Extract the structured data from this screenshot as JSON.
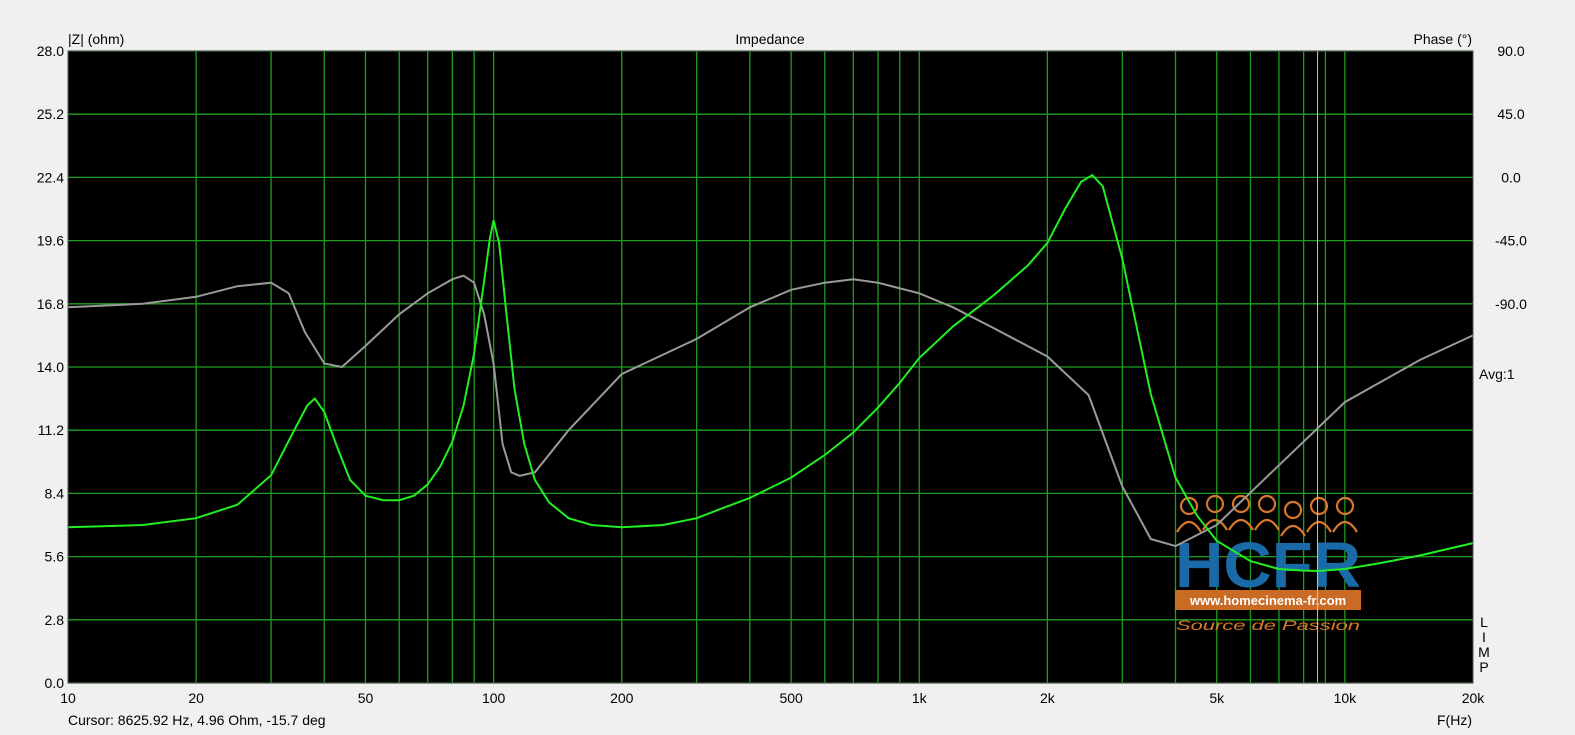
{
  "chart_data": {
    "type": "line",
    "title": "Impedance",
    "left_axis_label": "|Z| (ohm)",
    "right_axis_label": "Phase (°)",
    "x_axis_label": "F(Hz)",
    "x_scale": "log",
    "xlim": [
      10,
      20000
    ],
    "ylim_left": [
      0,
      28
    ],
    "ylim_right": [
      -90,
      90
    ],
    "left_ticks": [
      "0.0",
      "2.8",
      "5.6",
      "8.4",
      "11.2",
      "14.0",
      "16.8",
      "19.6",
      "22.4",
      "25.2",
      "28.0"
    ],
    "right_ticks": [
      {
        "label": "90.0",
        "value": 28.0
      },
      {
        "label": "45.0",
        "value": 25.2
      },
      {
        "label": "0.0",
        "value": 22.4
      },
      {
        "label": "-45.0",
        "value": 19.6
      },
      {
        "label": "-90.0",
        "value": 16.8
      }
    ],
    "x_ticks": [
      {
        "label": "10",
        "value": 10
      },
      {
        "label": "20",
        "value": 20
      },
      {
        "label": "50",
        "value": 50
      },
      {
        "label": "100",
        "value": 100
      },
      {
        "label": "200",
        "value": 200
      },
      {
        "label": "500",
        "value": 500
      },
      {
        "label": "1k",
        "value": 1000
      },
      {
        "label": "2k",
        "value": 2000
      },
      {
        "label": "5k",
        "value": 5000
      },
      {
        "label": "10k",
        "value": 10000
      },
      {
        "label": "20k",
        "value": 20000
      }
    ],
    "x_gridlines": [
      20,
      30,
      40,
      50,
      60,
      70,
      80,
      90,
      100,
      200,
      300,
      400,
      500,
      600,
      700,
      800,
      900,
      1000,
      2000,
      3000,
      4000,
      5000,
      6000,
      7000,
      8000,
      9000,
      10000
    ],
    "cursor_freq": 8625.92,
    "avg_label": "Avg:1",
    "lim_letters": [
      "L",
      "I",
      "M",
      "P"
    ],
    "cursor_text": "Cursor: 8625.92 Hz, 4.96 Ohm, -15.7 deg",
    "grid": true,
    "colors": {
      "background": "#000000",
      "frame": "#f0f0f0",
      "grid": "#1e9e1e",
      "impedance": "#22ee22",
      "phase": "#9a9a9a",
      "cursor": "#e8d23a"
    },
    "series": [
      {
        "name": "",
        "axis": "left",
        "points": [
          [
            10,
            6.9
          ],
          [
            15,
            7.0
          ],
          [
            20,
            7.3
          ],
          [
            25,
            7.9
          ],
          [
            30,
            9.2
          ],
          [
            34,
            11.2
          ],
          [
            36.5,
            12.3
          ],
          [
            38,
            12.6
          ],
          [
            40,
            12.0
          ],
          [
            43,
            10.4
          ],
          [
            46,
            9.0
          ],
          [
            50,
            8.3
          ],
          [
            55,
            8.1
          ],
          [
            60,
            8.1
          ],
          [
            65,
            8.3
          ],
          [
            70,
            8.8
          ],
          [
            75,
            9.6
          ],
          [
            80,
            10.7
          ],
          [
            85,
            12.3
          ],
          [
            90,
            14.6
          ],
          [
            95,
            17.8
          ],
          [
            98,
            19.7
          ],
          [
            100,
            20.5
          ],
          [
            103,
            19.5
          ],
          [
            107,
            16.5
          ],
          [
            112,
            13.0
          ],
          [
            118,
            10.6
          ],
          [
            125,
            9.0
          ],
          [
            135,
            8.0
          ],
          [
            150,
            7.3
          ],
          [
            170,
            7.0
          ],
          [
            200,
            6.9
          ],
          [
            250,
            7.0
          ],
          [
            300,
            7.3
          ],
          [
            340,
            7.7
          ],
          [
            400,
            8.2
          ],
          [
            500,
            9.1
          ],
          [
            600,
            10.1
          ],
          [
            700,
            11.1
          ],
          [
            800,
            12.2
          ],
          [
            900,
            13.3
          ],
          [
            1000,
            14.4
          ],
          [
            1200,
            15.8
          ],
          [
            1500,
            17.2
          ],
          [
            1800,
            18.5
          ],
          [
            2000,
            19.5
          ],
          [
            2200,
            21.0
          ],
          [
            2400,
            22.2
          ],
          [
            2550,
            22.5
          ],
          [
            2700,
            22.0
          ],
          [
            3000,
            18.8
          ],
          [
            3500,
            12.8
          ],
          [
            4000,
            9.1
          ],
          [
            4500,
            7.4
          ],
          [
            5000,
            6.3
          ],
          [
            6000,
            5.4
          ],
          [
            7000,
            5.05
          ],
          [
            8000,
            4.98
          ],
          [
            8626,
            4.96
          ],
          [
            10000,
            5.05
          ],
          [
            12000,
            5.3
          ],
          [
            15000,
            5.65
          ],
          [
            18000,
            6.0
          ],
          [
            20000,
            6.2
          ]
        ]
      },
      {
        "name": "",
        "axis": "right",
        "points": [
          [
            10,
            17
          ],
          [
            15,
            18
          ],
          [
            20,
            20
          ],
          [
            25,
            23
          ],
          [
            30,
            24
          ],
          [
            33,
            21
          ],
          [
            36,
            10
          ],
          [
            40,
            1
          ],
          [
            44,
            0
          ],
          [
            50,
            6
          ],
          [
            60,
            15
          ],
          [
            70,
            21
          ],
          [
            80,
            25
          ],
          [
            85,
            26
          ],
          [
            90,
            24
          ],
          [
            95,
            15
          ],
          [
            100,
            1
          ],
          [
            105,
            -22
          ],
          [
            110,
            -30
          ],
          [
            115,
            -31
          ],
          [
            125,
            -30
          ],
          [
            150,
            -18
          ],
          [
            200,
            -2
          ],
          [
            300,
            8
          ],
          [
            400,
            17
          ],
          [
            500,
            22
          ],
          [
            600,
            24
          ],
          [
            700,
            25
          ],
          [
            800,
            24
          ],
          [
            1000,
            21
          ],
          [
            1200,
            17
          ],
          [
            1500,
            11
          ],
          [
            2000,
            3
          ],
          [
            2500,
            -8
          ],
          [
            3000,
            -34
          ],
          [
            3500,
            -49
          ],
          [
            4000,
            -51
          ],
          [
            5000,
            -45
          ],
          [
            7000,
            -28
          ],
          [
            10000,
            -10
          ],
          [
            15000,
            2
          ],
          [
            20000,
            9
          ]
        ]
      }
    ],
    "watermark": {
      "logo": "HCFR",
      "url": "www.homecinema-fr.com",
      "tagline": "Source de Passion"
    }
  }
}
